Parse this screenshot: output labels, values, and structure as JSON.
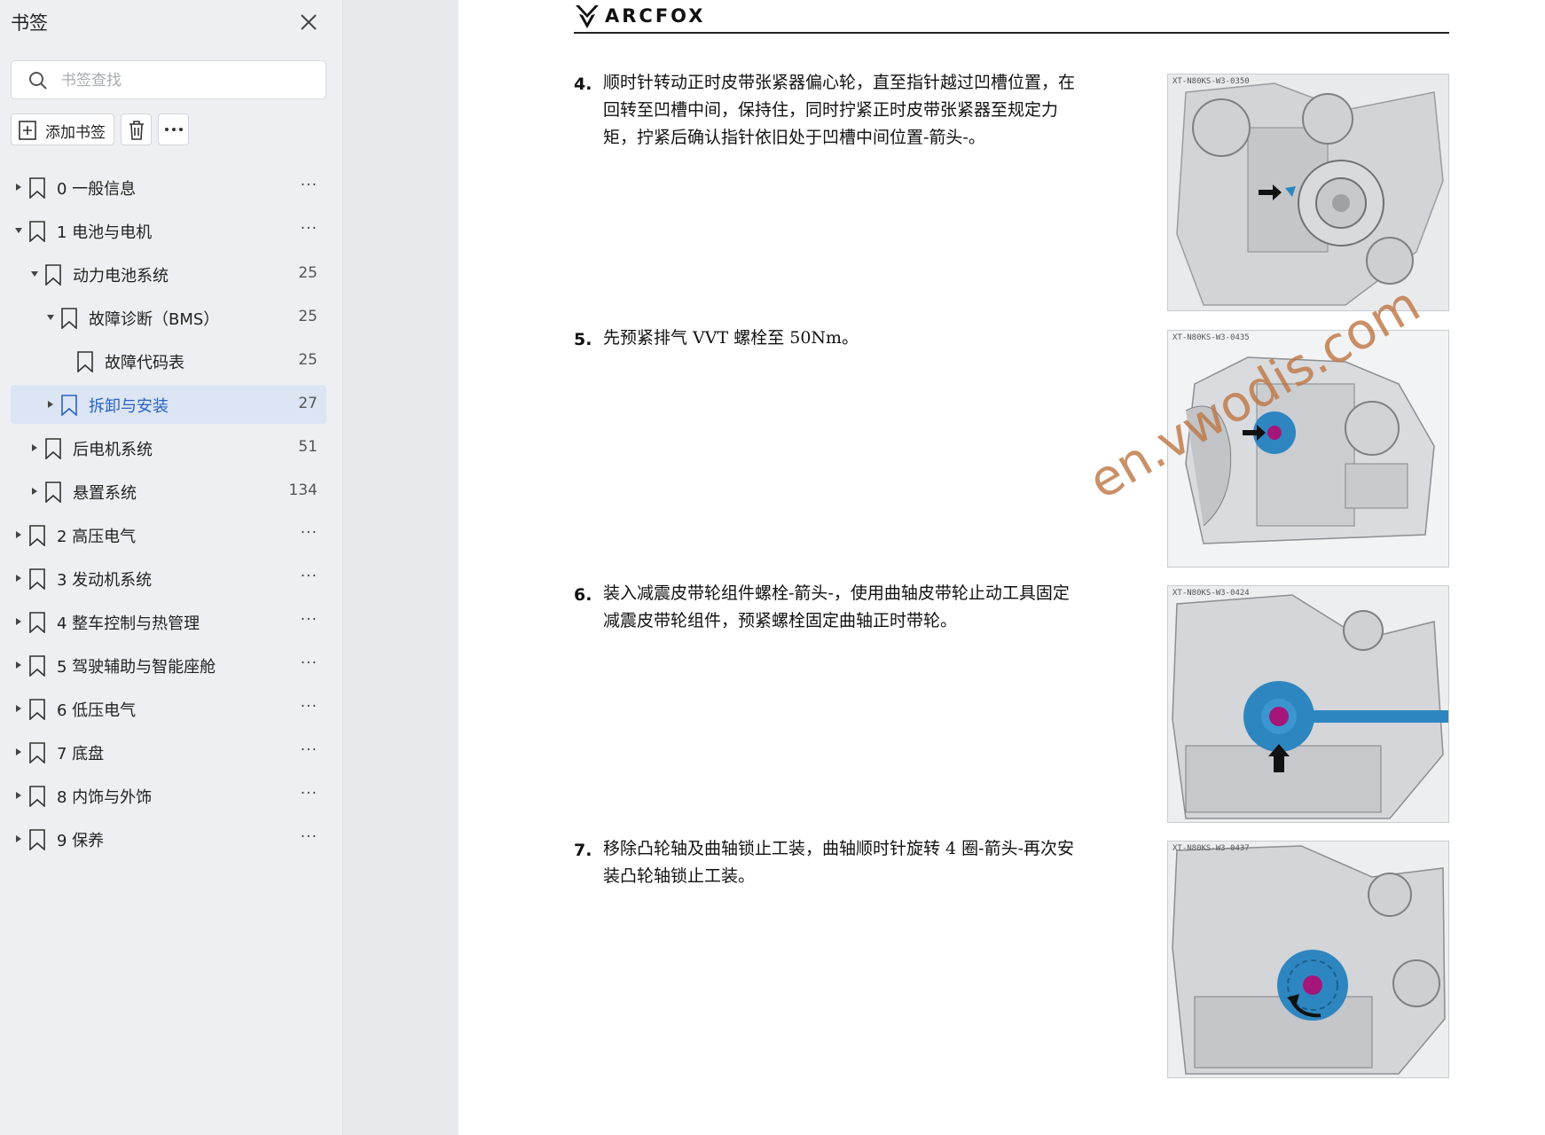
{
  "sidebar": {
    "title": "书签",
    "search_placeholder": "书签查找",
    "add_bookmark_label": "添加书签",
    "tree": [
      {
        "label": "0 一般信息",
        "count": "...",
        "expanded": false
      },
      {
        "label": "1 电池与电机",
        "count": "...",
        "expanded": true
      },
      {
        "label": "动力电池系统",
        "count": "25",
        "expanded": true
      },
      {
        "label": "故障诊断（BMS）",
        "count": "25",
        "expanded": true
      },
      {
        "label": "故障代码表",
        "count": "25",
        "expanded": null
      },
      {
        "label": "拆卸与安装",
        "count": "27",
        "expanded": false,
        "selected": true
      },
      {
        "label": "后电机系统",
        "count": "51",
        "expanded": false
      },
      {
        "label": "悬置系统",
        "count": "134",
        "expanded": false
      },
      {
        "label": "2 高压电气",
        "count": "...",
        "expanded": false
      },
      {
        "label": "3 发动机系统",
        "count": "...",
        "expanded": false
      },
      {
        "label": "4 整车控制与热管理",
        "count": "...",
        "expanded": false
      },
      {
        "label": "5 驾驶辅助与智能座舱",
        "count": "...",
        "expanded": false
      },
      {
        "label": "6 低压电气",
        "count": "...",
        "expanded": false
      },
      {
        "label": "7 底盘",
        "count": "...",
        "expanded": false
      },
      {
        "label": "8 内饰与外饰",
        "count": "...",
        "expanded": false
      },
      {
        "label": "9 保养",
        "count": "...",
        "expanded": false
      }
    ]
  },
  "document": {
    "brand": "ARCFOX",
    "watermark": "en.vwodis.com",
    "steps": [
      {
        "num": "4.",
        "text": "顺时针转动正时皮带张紧器偏心轮，直至指针越过凹槽位置，在回转至凹槽中间，保持住，同时拧紧正时皮带张紧器至规定力矩，拧紧后确认指针依旧处于凹槽中间位置-箭头-。",
        "figure_code": "XT-N80KS-W3-0350"
      },
      {
        "num": "5.",
        "text": "先预紧排气 VVT 螺栓至 50Nm。",
        "figure_code": "XT-N80KS-W3-0435"
      },
      {
        "num": "6.",
        "text": "装入减震皮带轮组件螺栓-箭头-，使用曲轴皮带轮止动工具固定减震皮带轮组件，预紧螺栓固定曲轴正时带轮。",
        "figure_code": "XT-N80KS-W3-0424"
      },
      {
        "num": "7.",
        "text": "移除凸轮轴及曲轴锁止工装，曲轴顺时针旋转 4 圈-箭头-再次安装凸轮轴锁止工装。",
        "figure_code": "XT-N80KS-W3-0437"
      }
    ]
  },
  "colors": {
    "selected_bg": "#dbe5f3",
    "selected_text": "#2b62c4",
    "highlight_blue": "#2e86c1",
    "bolt_magenta": "#a5167a"
  }
}
